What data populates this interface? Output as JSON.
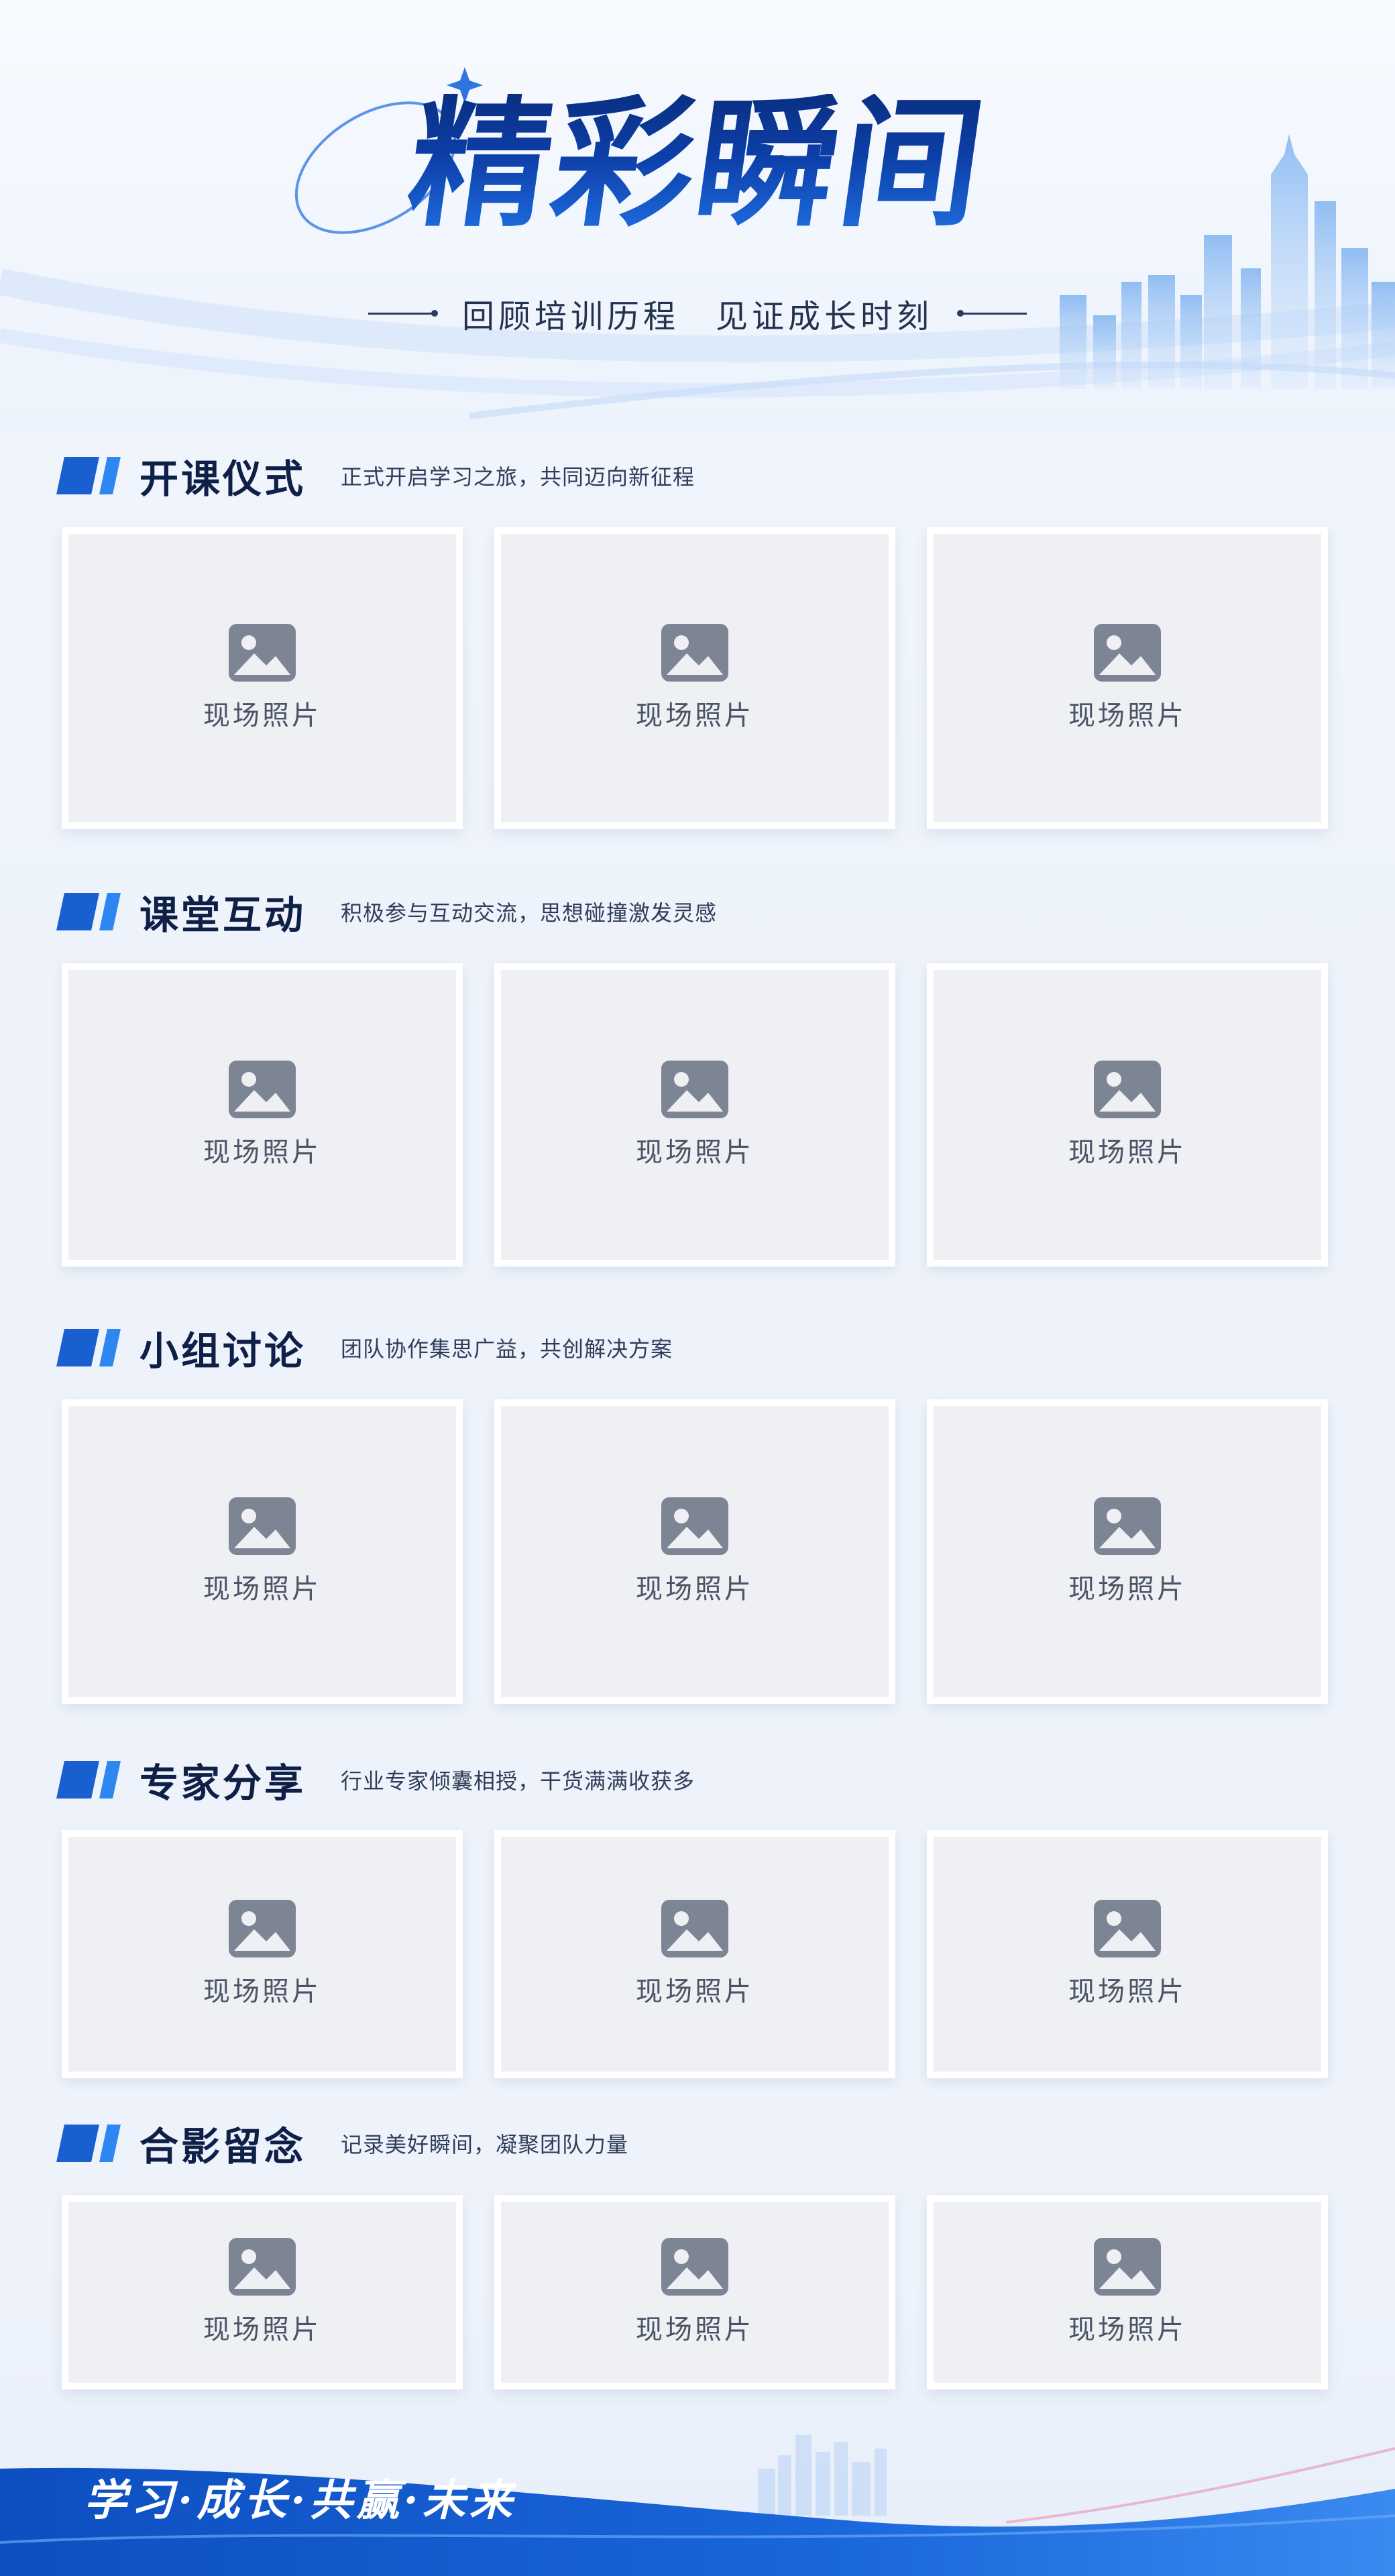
{
  "header": {
    "title": "精彩瞬间",
    "subtitle": "回顾培训历程　见证成长时刻"
  },
  "placeholder_label": "现场照片",
  "sections": [
    {
      "title": "开课仪式",
      "desc": "正式开启学习之旅，共同迈向新征程"
    },
    {
      "title": "课堂互动",
      "desc": "积极参与互动交流，思想碰撞激发灵感"
    },
    {
      "title": "小组讨论",
      "desc": "团队协作集思广益，共创解决方案"
    },
    {
      "title": "专家分享",
      "desc": "行业专家倾囊相授，干货满满收获多"
    },
    {
      "title": "合影留念",
      "desc": "记录美好瞬间，凝聚团队力量"
    }
  ],
  "footer": {
    "slogan": "学习·成长·共赢·未来"
  },
  "colors": {
    "title_dark": "#0a2f82",
    "accent_blue": "#1a5fd0",
    "accent_light": "#2e86f0",
    "placeholder_bg": "#eef0f4",
    "icon_gray": "#7d8594"
  },
  "icons": {
    "photo": "image-placeholder-icon",
    "sparkle": "sparkle-icon"
  }
}
